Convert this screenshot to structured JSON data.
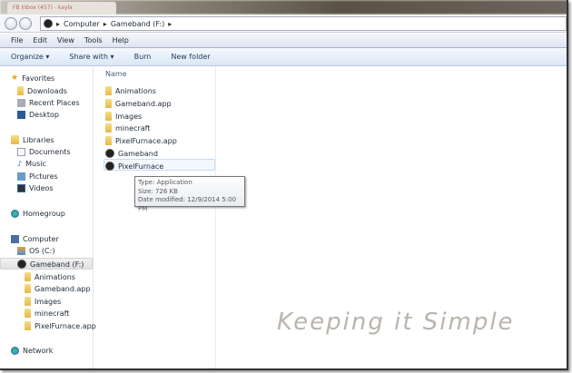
{
  "browser_tab": "FB Inbox (457) - kayla",
  "address": {
    "crumbs": [
      "Computer",
      "Gameband (F:)"
    ]
  },
  "menu": [
    "File",
    "Edit",
    "View",
    "Tools",
    "Help"
  ],
  "toolbar": {
    "organize": "Organize ▾",
    "share": "Share with ▾",
    "burn": "Burn",
    "new_folder": "New folder"
  },
  "nav": {
    "favorites": "Favorites",
    "downloads": "Downloads",
    "recent": "Recent Places",
    "desktop": "Desktop",
    "libraries": "Libraries",
    "documents": "Documents",
    "music": "Music",
    "pictures": "Pictures",
    "videos": "Videos",
    "homegroup": "Homegroup",
    "computer": "Computer",
    "os": "OS (C:)",
    "gameband": "Gameband (F:)",
    "sub": [
      "Animations",
      "Gameband.app",
      "Images",
      "minecraft",
      "PixelFurnace.app"
    ],
    "network": "Network"
  },
  "list": {
    "column_name": "Name",
    "items": [
      "Animations",
      "Gameband.app",
      "Images",
      "minecraft",
      "PixelFurnace.app",
      "Gameband",
      "PixelFurnace"
    ]
  },
  "tooltip": {
    "type": "Type: Application",
    "size": "Size: 726 KB",
    "date": "Date modified: 12/9/2014 5:00 PM"
  },
  "watermark": "Keeping it Simple"
}
